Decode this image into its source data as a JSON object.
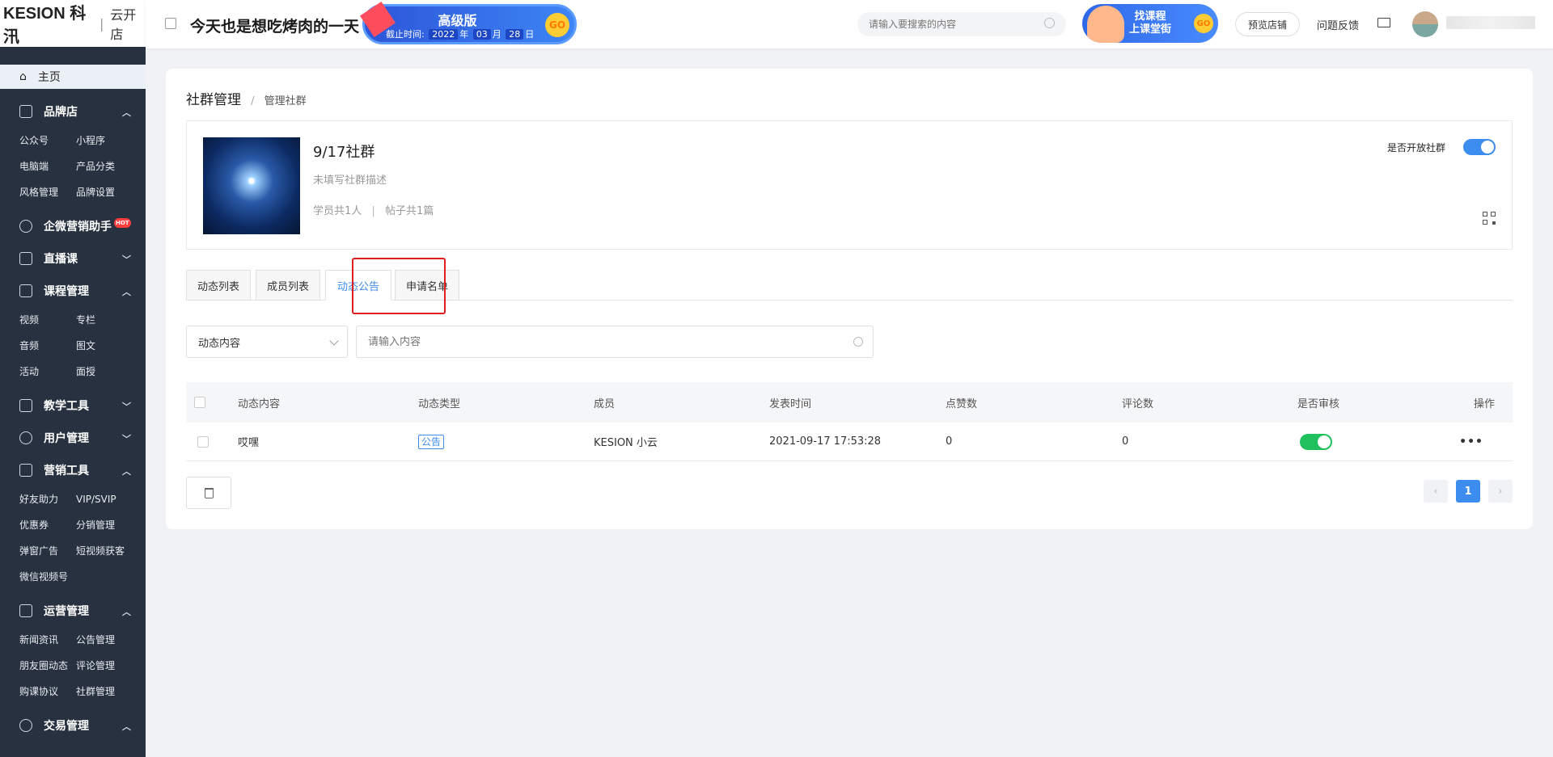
{
  "logo": {
    "brand": "KESION 科汛",
    "sub": "云开店"
  },
  "header": {
    "title": "今天也是想吃烤肉的一天",
    "pro_banner": {
      "name": "高级版",
      "expire_label": "截止时间:",
      "year": "2022",
      "year_unit": "年",
      "month": "03",
      "month_unit": "月",
      "day": "28",
      "day_unit": "日",
      "go": "GO"
    },
    "search_placeholder": "请输入要搜索的内容",
    "course_banner": {
      "line1": "找课程",
      "line2": "上课堂街",
      "go": "GO"
    },
    "preview_label": "预览店铺",
    "feedback_label": "问题反馈"
  },
  "sidebar": {
    "home": "主页",
    "groups": [
      {
        "label": "品牌店",
        "icon": "store-icon",
        "expanded": true,
        "items": [
          "公众号",
          "小程序",
          "电脑端",
          "产品分类",
          "风格管理",
          "品牌设置"
        ]
      },
      {
        "label": "企微营销助手",
        "icon": "chat-icon",
        "badge": "HOT",
        "items": []
      },
      {
        "label": "直播课",
        "icon": "camera-icon",
        "expanded": false,
        "items": []
      },
      {
        "label": "课程管理",
        "icon": "course-icon",
        "expanded": true,
        "items": [
          "视频",
          "专栏",
          "音频",
          "图文",
          "活动",
          "面授"
        ]
      },
      {
        "label": "教学工具",
        "icon": "cart-icon",
        "expanded": false,
        "items": []
      },
      {
        "label": "用户管理",
        "icon": "user-icon",
        "expanded": false,
        "items": []
      },
      {
        "label": "营销工具",
        "icon": "gift-icon",
        "expanded": true,
        "items": [
          "好友助力",
          "VIP/SVIP",
          "优惠券",
          "分销管理",
          "弹窗广告",
          "短视频获客",
          "微信视频号"
        ]
      },
      {
        "label": "运营管理",
        "icon": "layers-icon",
        "expanded": true,
        "items": [
          "新闻资讯",
          "公告管理",
          "朋友圈动态",
          "评论管理",
          "购课协议",
          "社群管理"
        ]
      },
      {
        "label": "交易管理",
        "icon": "yen-icon",
        "expanded": true,
        "items": []
      }
    ]
  },
  "breadcrumb": {
    "root": "社群管理",
    "current": "管理社群"
  },
  "community": {
    "name": "9/17社群",
    "desc": "未填写社群描述",
    "students": "学员共1人",
    "posts": "帖子共1篇",
    "open_label": "是否开放社群",
    "open": true
  },
  "tabs": [
    {
      "label": "动态列表",
      "active": false
    },
    {
      "label": "成员列表",
      "active": false
    },
    {
      "label": "动态公告",
      "active": true
    },
    {
      "label": "申请名单",
      "active": false
    }
  ],
  "filter": {
    "select_value": "动态内容",
    "input_placeholder": "请输入内容"
  },
  "table": {
    "columns": [
      "动态内容",
      "动态类型",
      "成员",
      "发表时间",
      "点赞数",
      "评论数",
      "是否审核",
      "操作"
    ],
    "rows": [
      {
        "content": "哎嘿",
        "type": "公告",
        "member": "KESION 小云",
        "time": "2021-09-17 17:53:28",
        "likes": "0",
        "comments": "0",
        "approved": true,
        "action": "•••"
      }
    ]
  },
  "pager": {
    "prev": "‹",
    "current": "1",
    "next": "›"
  },
  "colors": {
    "accent": "#3d8cf0",
    "sidebar": "#27313f",
    "approved": "#20c05c",
    "highlight": "#e02020"
  }
}
